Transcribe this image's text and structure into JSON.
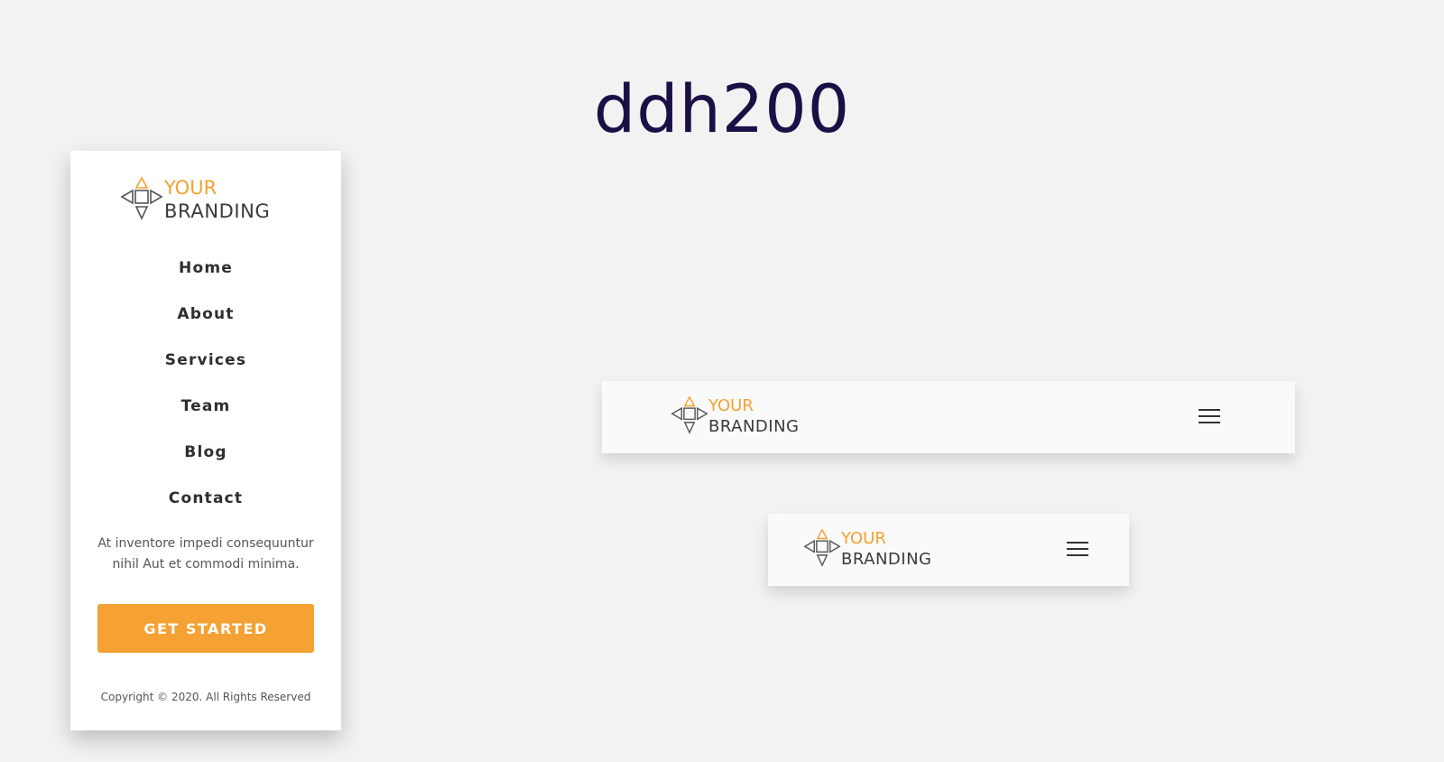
{
  "page": {
    "title": "ddh200"
  },
  "brand": {
    "line1": "YOUR",
    "line2": "BRANDING",
    "logo_icon": "diamond-arrows-logo-icon",
    "accent_color": "#f5a130",
    "dark_color": "#3a3a3a"
  },
  "mobile_menu": {
    "nav_items": [
      {
        "label": "Home"
      },
      {
        "label": "About"
      },
      {
        "label": "Services"
      },
      {
        "label": "Team"
      },
      {
        "label": "Blog"
      },
      {
        "label": "Contact"
      }
    ],
    "tagline": "At inventore impedi consequuntur nihil Aut et commodi minima.",
    "cta_label": "GET STARTED",
    "cta_color": "#f5a133",
    "copyright": "Copyright © 2020. All Rights Reserved"
  },
  "header_wide": {
    "menu_icon": "hamburger-menu-icon"
  },
  "header_narrow": {
    "menu_icon": "hamburger-menu-icon"
  }
}
